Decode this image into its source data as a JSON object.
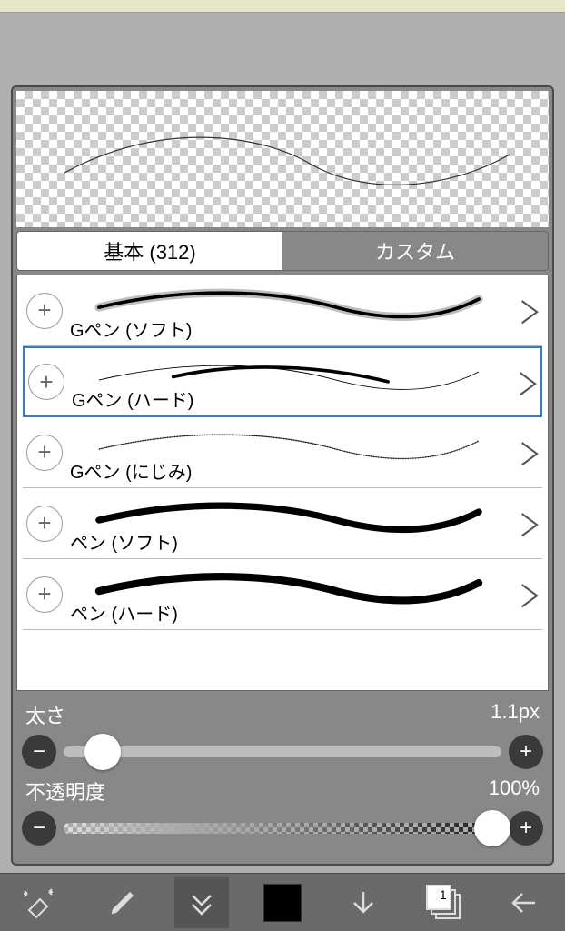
{
  "tabs": {
    "basic_label": "基本 (312)",
    "custom_label": "カスタム"
  },
  "brushes": [
    {
      "name": "Gペン (ソフト)",
      "selected": false,
      "style": "soft-g"
    },
    {
      "name": "Gペン (ハード)",
      "selected": true,
      "style": "hard-g"
    },
    {
      "name": "Gペン (にじみ)",
      "selected": false,
      "style": "bleed-g"
    },
    {
      "name": "ペン (ソフト)",
      "selected": false,
      "style": "soft-pen"
    },
    {
      "name": "ペン (ハード)",
      "selected": false,
      "style": "hard-pen"
    }
  ],
  "size": {
    "label": "太さ",
    "value_text": "1.1px",
    "thumb_pct": 9
  },
  "opacity": {
    "label": "不透明度",
    "value_text": "100%",
    "thumb_pct": 98
  },
  "layers_count": "1",
  "icons": {
    "plus": "+",
    "minus": "−",
    "chevron_right": "＞"
  }
}
